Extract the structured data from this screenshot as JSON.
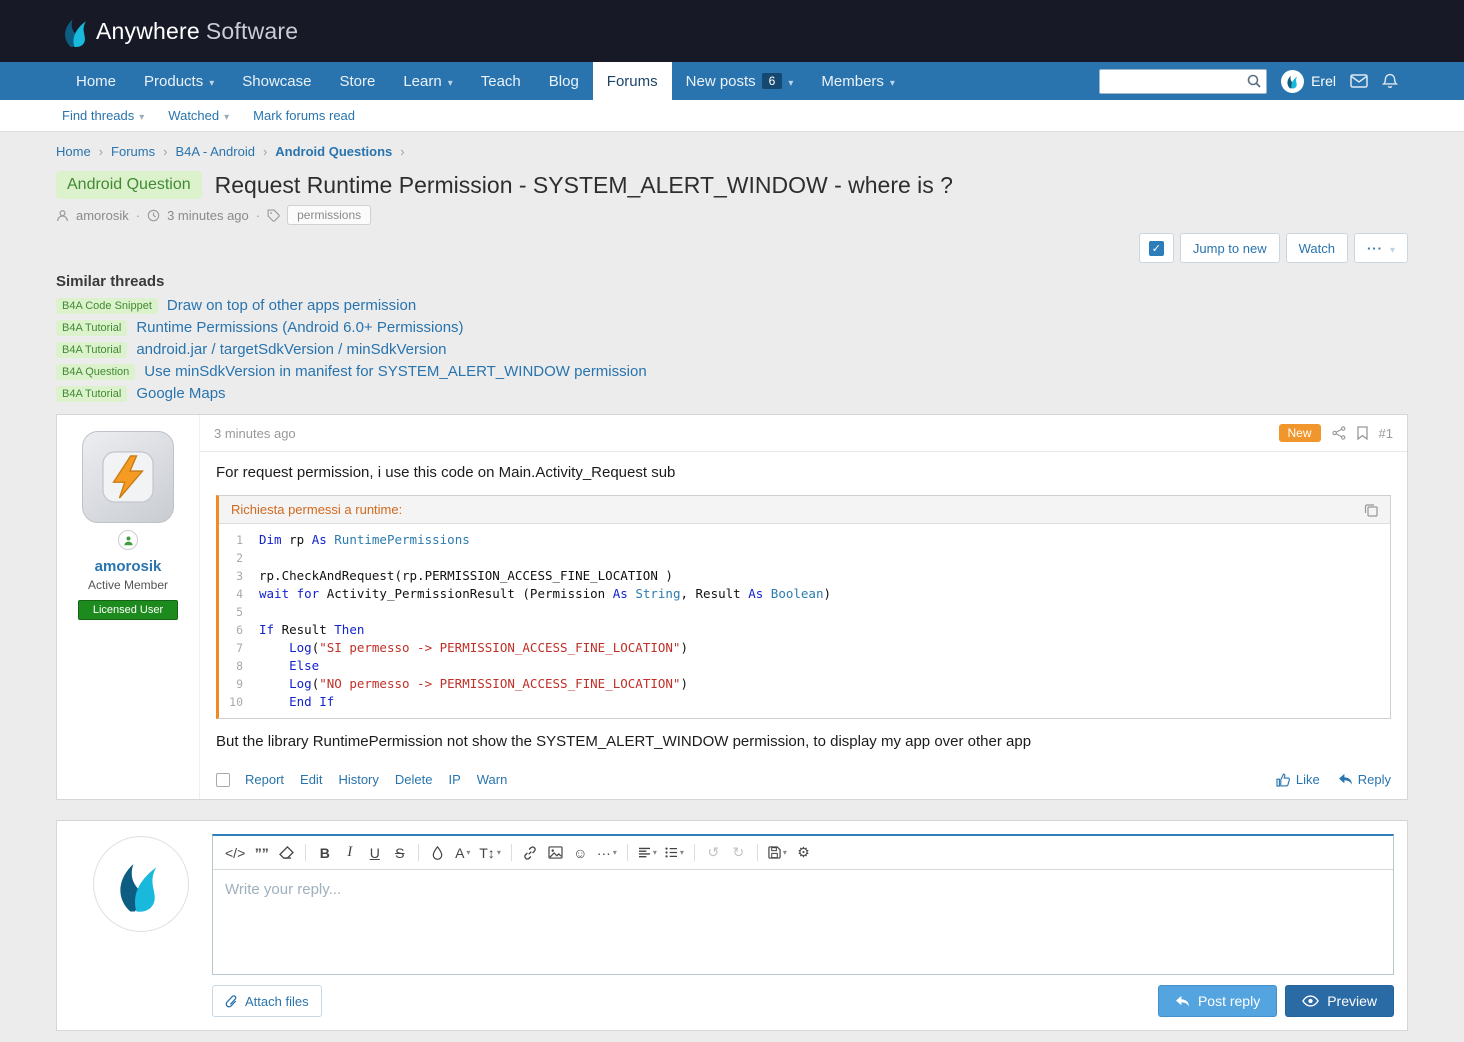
{
  "colors": {
    "nav_blue": "#2974ae",
    "header_dark": "#171a26",
    "accent_orange": "#f08a24",
    "new_badge": "#f0962d",
    "question_badge_bg": "#dcf2cd",
    "question_badge_text": "#418a32",
    "licensed_green": "#1d8a1d",
    "post_reply_blue": "#54a4df",
    "preview_blue": "#2b6ba5"
  },
  "brand": {
    "name_first": "Anywhere",
    "name_second": "Software"
  },
  "nav": {
    "items": [
      {
        "label": "Home"
      },
      {
        "label": "Products"
      },
      {
        "label": "Showcase"
      },
      {
        "label": "Store"
      },
      {
        "label": "Learn"
      },
      {
        "label": "Teach"
      },
      {
        "label": "Blog"
      },
      {
        "label": "Forums"
      },
      {
        "label": "New posts",
        "badge": "6"
      },
      {
        "label": "Members"
      }
    ],
    "user_name": "Erel"
  },
  "subnav": {
    "items": [
      {
        "label": "Find threads"
      },
      {
        "label": "Watched"
      },
      {
        "label": "Mark forums read"
      }
    ]
  },
  "breadcrumb": {
    "items": [
      "Home",
      "Forums",
      "B4A - Android",
      "Android Questions"
    ]
  },
  "thread": {
    "category_badge": "Android Question",
    "title": "Request Runtime Permission - SYSTEM_ALERT_WINDOW - where is ?",
    "author": "amorosik",
    "time": "3 minutes ago",
    "tag": "permissions",
    "jump_to_new": "Jump to new",
    "watch": "Watch"
  },
  "similar": {
    "heading": "Similar threads",
    "items": [
      {
        "badge": "B4A Code Snippet",
        "title": "Draw on top of other apps permission"
      },
      {
        "badge": "B4A Tutorial",
        "title": "Runtime Permissions (Android 6.0+ Permissions)"
      },
      {
        "badge": "B4A Tutorial",
        "title": "android.jar / targetSdkVersion / minSdkVersion"
      },
      {
        "badge": "B4A Question",
        "title": "Use minSdkVersion in manifest for SYSTEM_ALERT_WINDOW permission"
      },
      {
        "badge": "B4A Tutorial",
        "title": "Google Maps"
      }
    ]
  },
  "post": {
    "time": "3 minutes ago",
    "new_badge": "New",
    "number": "#1",
    "author": {
      "name": "amorosik",
      "title": "Active Member",
      "banner": "Licensed User"
    },
    "intro": "For request permission, i use this code on Main.Activity_Request sub",
    "code": {
      "title": "Richiesta permessi a runtime:",
      "lines": [
        [
          [
            "kw",
            "Dim"
          ],
          [
            "pl",
            " rp "
          ],
          [
            "kw",
            "As"
          ],
          [
            "pl",
            " "
          ],
          [
            "type",
            "RuntimePermissions"
          ]
        ],
        [],
        [
          [
            "pl",
            "rp.CheckAndRequest(rp.PERMISSION_ACCESS_FINE_LOCATION )"
          ]
        ],
        [
          [
            "kw",
            "wait for"
          ],
          [
            "pl",
            " Activity_PermissionResult (Permission "
          ],
          [
            "kw",
            "As"
          ],
          [
            "pl",
            " "
          ],
          [
            "type",
            "String"
          ],
          [
            "pl",
            ", Result "
          ],
          [
            "kw",
            "As"
          ],
          [
            "pl",
            " "
          ],
          [
            "type",
            "Boolean"
          ],
          [
            "pl",
            ")"
          ]
        ],
        [],
        [
          [
            "kw",
            "If"
          ],
          [
            "pl",
            " Result "
          ],
          [
            "kw",
            "Then"
          ]
        ],
        [
          [
            "pl",
            "    "
          ],
          [
            "kw",
            "Log"
          ],
          [
            "pl",
            "("
          ],
          [
            "str",
            "\"SI permesso -> PERMISSION_ACCESS_FINE_LOCATION\""
          ],
          [
            "pl",
            ")"
          ]
        ],
        [
          [
            "pl",
            "    "
          ],
          [
            "kw",
            "Else"
          ]
        ],
        [
          [
            "pl",
            "    "
          ],
          [
            "kw",
            "Log"
          ],
          [
            "pl",
            "("
          ],
          [
            "str",
            "\"NO permesso -> PERMISSION_ACCESS_FINE_LOCATION\""
          ],
          [
            "pl",
            ")"
          ]
        ],
        [
          [
            "pl",
            "    "
          ],
          [
            "kw",
            "End If"
          ]
        ]
      ]
    },
    "outro": "But the library RuntimePermission not show the SYSTEM_ALERT_WINDOW permission, to display my app over other app",
    "links": [
      "Report",
      "Edit",
      "History",
      "Delete",
      "IP",
      "Warn"
    ],
    "like": "Like",
    "reply": "Reply"
  },
  "reply": {
    "placeholder": "Write your reply...",
    "attach": "Attach files",
    "post_button": "Post reply",
    "preview_button": "Preview",
    "toolbar": [
      {
        "name": "code-icon",
        "glyph": "</>"
      },
      {
        "name": "quote-icon",
        "glyph": "””",
        "cls": "b"
      },
      {
        "name": "remove-format-icon",
        "icon": "eraser"
      },
      {
        "sep": true
      },
      {
        "name": "bold-icon",
        "glyph": "B",
        "cls": "b"
      },
      {
        "name": "italic-icon",
        "glyph": "I",
        "cls": "i"
      },
      {
        "name": "underline-icon",
        "glyph": "U",
        "cls": "u"
      },
      {
        "name": "strike-icon",
        "glyph": "S",
        "cls": "s"
      },
      {
        "sep": true
      },
      {
        "name": "text-color-icon",
        "icon": "droplet"
      },
      {
        "name": "font-family-icon",
        "glyph": "A",
        "caret": true
      },
      {
        "name": "font-size-icon",
        "glyph": "T↕",
        "caret": true
      },
      {
        "sep": true
      },
      {
        "name": "link-icon",
        "icon": "link"
      },
      {
        "name": "image-icon",
        "icon": "image"
      },
      {
        "name": "smilie-icon",
        "glyph": "☺"
      },
      {
        "name": "more-options-icon",
        "glyph": "···",
        "caret": true
      },
      {
        "sep": true
      },
      {
        "name": "alignment-icon",
        "icon": "align",
        "caret": true
      },
      {
        "name": "list-icon",
        "icon": "list",
        "caret": true
      },
      {
        "sep": true
      },
      {
        "name": "undo-icon",
        "glyph": "↺",
        "cls": "disabled"
      },
      {
        "name": "redo-icon",
        "glyph": "↻",
        "cls": "disabled"
      },
      {
        "sep": true
      },
      {
        "name": "drafts-icon",
        "icon": "save",
        "caret": true
      },
      {
        "name": "settings-icon",
        "glyph": "⚙"
      }
    ]
  }
}
